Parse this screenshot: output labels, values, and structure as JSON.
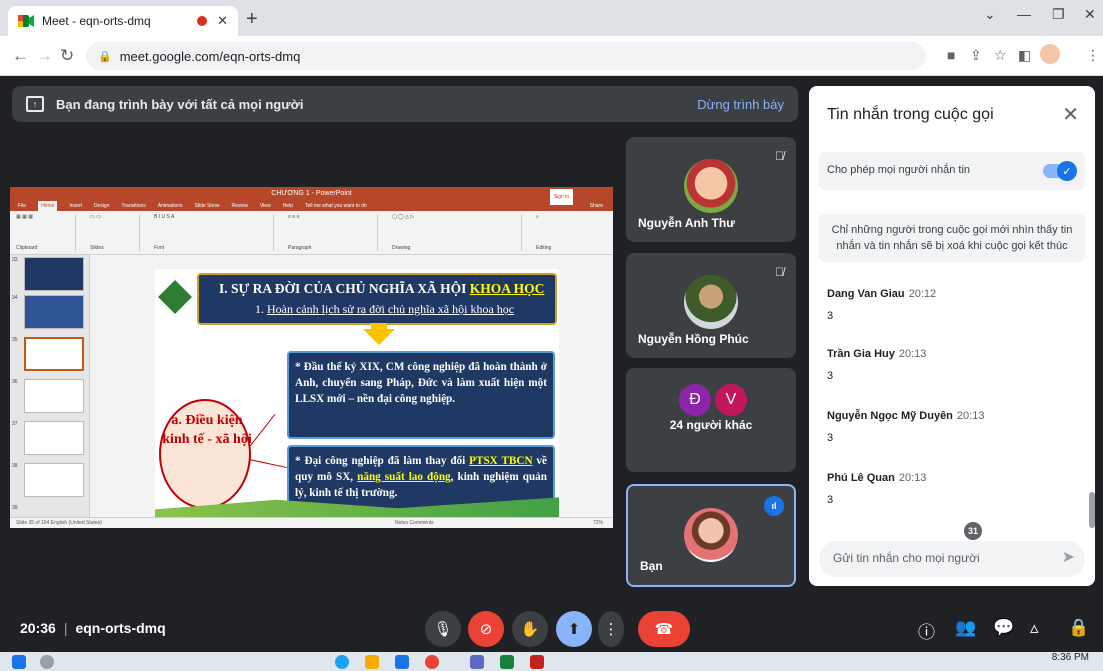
{
  "browser": {
    "tab_title": "Meet - eqn-orts-dmq",
    "url": "meet.google.com/eqn-orts-dmq"
  },
  "presenting": {
    "banner": "Bạn đang trình bày với tất cả mọi người",
    "stop_label": "Dừng trình bày"
  },
  "ppt": {
    "window_title": "CHƯƠNG 1 - PowerPoint",
    "sign_in": "Sign in",
    "tabs": [
      "File",
      "Home",
      "Insert",
      "Design",
      "Transitions",
      "Animations",
      "Slide Show",
      "Review",
      "View",
      "Help"
    ],
    "tell_me": "Tell me what you want to do",
    "share": "Share",
    "ribbon_groups": [
      "Clipboard",
      "Slides",
      "Font",
      "Paragraph",
      "Drawing",
      "Editing"
    ],
    "thumb_numbers": [
      "33",
      "34",
      "35",
      "36",
      "37",
      "38",
      "39"
    ],
    "status": "Slide 35 of 104   English (United States)",
    "status_right": "Notes   Comments",
    "zoom": "72%",
    "slide": {
      "title_prefix": "I. SỰ RA ĐỜI CỦA CHỦ NGHĨA XÃ HỘI ",
      "title_underlined": "KHOA HỌC",
      "subtitle_prefix": "1. ",
      "subtitle_underlined": "Hoàn cảnh lịch sử ra đời chủ nghĩa xã hội khoa học",
      "circle_text": "a. Điều kiện kinh tế - xã hội",
      "box1_text": "* Đầu thế kỷ XIX, CM công nghiệp đã hoàn thành ở Anh, chuyển sang Pháp, Đức và làm xuất hiện một LLSX mới – nền đại công nghiệp.",
      "box2_prefix": "* Đại công nghiệp đã làm thay đổi ",
      "box2_hl1": "PTSX TBCN",
      "box2_mid": " về quy mô SX, ",
      "box2_hl2": "năng suất lao động",
      "box2_suffix": ", kinh nghiệm quản lý, kinh tế thị trường."
    }
  },
  "participants": [
    {
      "name": "Nguyễn Anh Thư",
      "muted": true
    },
    {
      "name": "Nguyễn Hồng Phúc",
      "muted": true
    },
    {
      "name": "24 người khác",
      "initials": [
        "Đ",
        "V"
      ]
    },
    {
      "name": "Bạn"
    }
  ],
  "chat": {
    "title": "Tin nhắn trong cuộc gọi",
    "allow_label": "Cho phép mọi người nhắn tin",
    "notice": "Chỉ những người trong cuộc gọi mới nhìn thấy tin nhắn và tin nhắn sẽ bị xoá khi cuộc gọi kết thúc",
    "messages": [
      {
        "sender": "Dang Van Giau",
        "time": "20:12",
        "text": "3"
      },
      {
        "sender": "Trần Gia Huy",
        "time": "20:13",
        "text": "3"
      },
      {
        "sender": "Nguyễn Ngọc Mỹ Duyên",
        "time": "20:13",
        "text": "3"
      },
      {
        "sender": "Phú Lê Quan",
        "time": "20:13",
        "text": "3"
      }
    ],
    "placeholder": "Gửi tin nhắn cho mọi người"
  },
  "bottom": {
    "time": "20:36",
    "meeting_code": "eqn-orts-dmq",
    "participant_count": "31"
  },
  "taskbar": {
    "clock": "8:36 PM"
  },
  "colors": {
    "meet_bg": "#202124",
    "accent": "#8ab4f8",
    "hangup": "#ea4335",
    "ppt": "#b7472a",
    "slide_box": "#1f3864"
  }
}
